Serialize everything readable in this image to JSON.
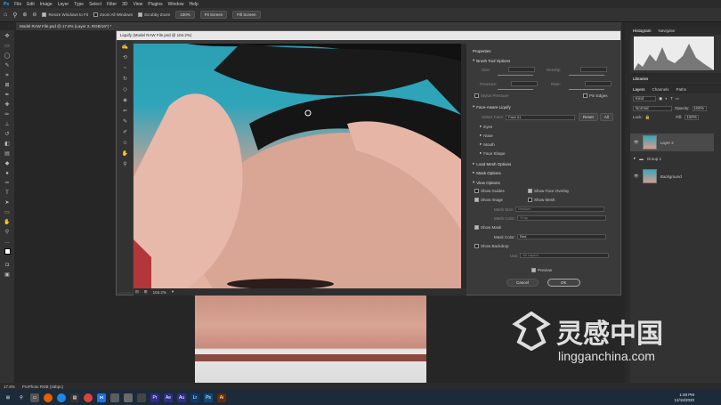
{
  "menu": [
    "File",
    "Edit",
    "Image",
    "Layer",
    "Type",
    "Select",
    "Filter",
    "3D",
    "View",
    "Plugins",
    "Window",
    "Help"
  ],
  "options_bar": {
    "resize_windows": "Resize Windows to Fit",
    "zoom_all": "Zoom All Windows",
    "scrubby_zoom": "Scrubby Zoom",
    "zoom_100": "100%",
    "fit_screen": "Fit Screen",
    "fill_screen": "Fill Screen"
  },
  "doc_tab": "Model RAW File.psd @ 17.8% (Layer 2, RGB/16*) *",
  "liquify": {
    "title": "Liquify (Model RAW File.psd @ 104.2%)",
    "zoom": "104.2%",
    "properties_title": "Properties",
    "brush_tool_options": "Brush Tool Options",
    "size": "Size:",
    "density": "Density:",
    "pressure": "Pressure:",
    "rate": "Rate:",
    "stylus_pressure": "Stylus Pressure",
    "pin_edges": "Pin Edges",
    "face_aware": "Face-Aware Liquify",
    "select_face": "Select Face:",
    "face_value": "Face #1",
    "reset": "Reset",
    "all": "All",
    "eyes": "Eyes",
    "nose": "Nose",
    "mouth": "Mouth",
    "face_shape": "Face Shape",
    "load_mesh": "Load Mesh Options",
    "mask_options": "Mask Options",
    "view_options": "View Options",
    "show_guides": "Show Guides",
    "show_face_overlay": "Show Face Overlay",
    "show_image": "Show Image",
    "show_mesh": "Show Mesh",
    "mesh_size": "Mesh Size:",
    "mesh_size_value": "Medium",
    "mesh_color": "Mesh Color:",
    "mesh_color_value": "Gray",
    "show_mask": "Show Mask",
    "mask_color": "Mask Color:",
    "mask_color_value": "Red",
    "show_backdrop": "Show Backdrop",
    "use": "Use:",
    "use_value": "All Layers",
    "preview": "Preview",
    "cancel": "Cancel",
    "ok": "OK"
  },
  "right_panels": {
    "histogram_tab": "Histogram",
    "navigator_tab": "Navigator",
    "libraries": "Libraries",
    "layers_tab": "Layers",
    "channels_tab": "Channels",
    "paths_tab": "Paths",
    "kind": "Kind",
    "blend_mode": "Normal",
    "opacity_label": "Opacity:",
    "opacity_value": "100%",
    "lock_label": "Lock:",
    "fill_label": "Fill:",
    "fill_value": "100%",
    "layers": [
      "Layer 2",
      "Group 1",
      "Background"
    ]
  },
  "status": {
    "zoom": "17.8%",
    "profile": "ProPhoto RGB (16bpc)"
  },
  "taskbar": {
    "time": "1:48 PM",
    "date": "12/18/2020"
  },
  "watermark": {
    "cn": "灵感中国",
    "url": "lingganchina.com"
  }
}
